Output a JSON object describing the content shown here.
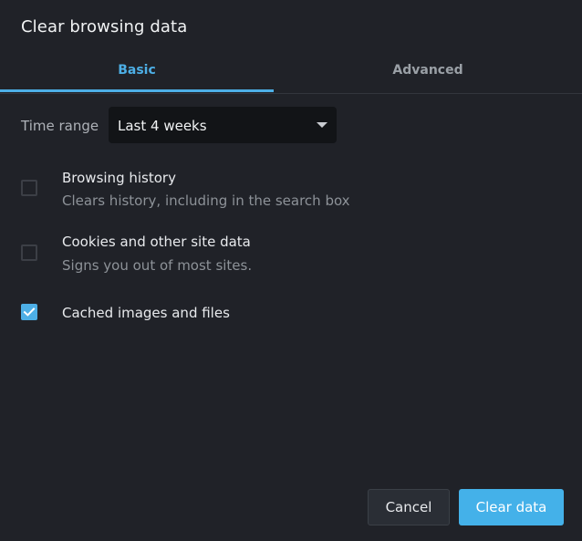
{
  "dialog": {
    "title": "Clear browsing data"
  },
  "tabs": [
    {
      "label": "Basic",
      "active": true
    },
    {
      "label": "Advanced",
      "active": false
    }
  ],
  "time_range": {
    "label": "Time range",
    "selected": "Last 4 weeks"
  },
  "options": [
    {
      "title": "Browsing history",
      "subtitle": "Clears history, including in the search box",
      "checked": false
    },
    {
      "title": "Cookies and other site data",
      "subtitle": "Signs you out of most sites.",
      "checked": false
    },
    {
      "title": "Cached images and files",
      "subtitle": "",
      "checked": true
    }
  ],
  "buttons": {
    "cancel": "Cancel",
    "clear": "Clear data"
  },
  "colors": {
    "background": "#202228",
    "accent": "#4dafe6",
    "select_bg": "#121417"
  }
}
